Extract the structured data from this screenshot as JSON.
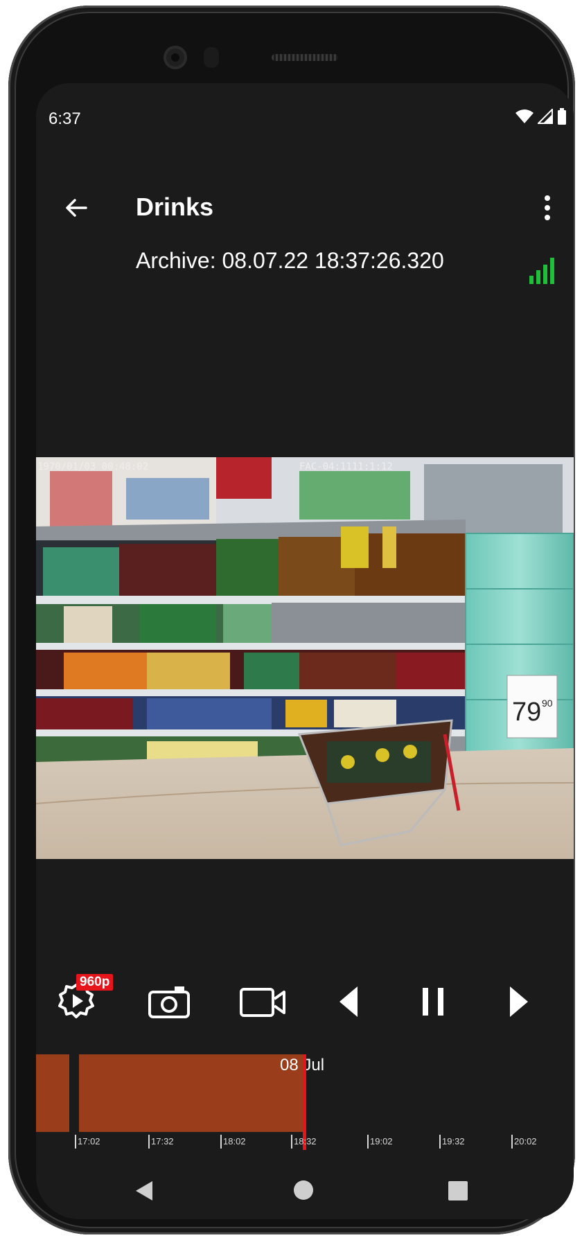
{
  "status_bar": {
    "time": "6:37",
    "icons": [
      "wifi-icon",
      "cell-signal-icon",
      "battery-icon"
    ]
  },
  "app_bar": {
    "title": "Drinks",
    "back_icon": "arrow-back-icon",
    "more_icon": "more-vert-icon"
  },
  "archive_label": "Archive: 08.07.22 18:37:26.320",
  "connection": {
    "icon": "signal-bars-icon",
    "color": "#1fbf3a",
    "strength_bars": 4
  },
  "video": {
    "osd_timestamp": "1970/01/03 00:48:02",
    "osd_channel": "FAC-04:1111:1:12",
    "price_tag": "79",
    "price_tag_cents": "90"
  },
  "controls": {
    "quality_badge": "960p",
    "items": [
      "settings-play-icon",
      "snapshot-camera-icon",
      "record-video-icon",
      "previous-icon",
      "pause-icon",
      "next-icon"
    ]
  },
  "timeline": {
    "date_label": "08 Jul",
    "ticks": [
      "17:02",
      "17:32",
      "18:02",
      "18:32",
      "19:02",
      "19:32",
      "20:02"
    ],
    "bar_color": "#9a3d1b",
    "cursor_color": "#e8141b"
  },
  "nav_bar": {
    "items": [
      "nav-back-icon",
      "nav-home-icon",
      "nav-recents-icon"
    ]
  }
}
